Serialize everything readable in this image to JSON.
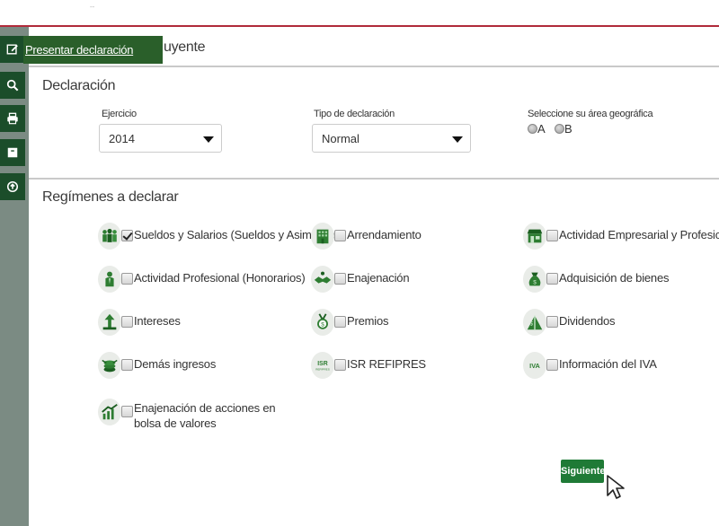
{
  "tooltip": {
    "label": "Presentar declaración"
  },
  "header": {
    "partial_title": "uyente"
  },
  "declaracion": {
    "title": "Declaración",
    "ejercicio": {
      "label": "Ejercicio",
      "value": "2014"
    },
    "tipo": {
      "label": "Tipo de declaración",
      "value": "Normal"
    },
    "area": {
      "label": "Seleccione su área geográfica",
      "option_a": "A",
      "option_b": "B"
    }
  },
  "regimenes": {
    "title": "Regímenes a declarar",
    "items": [
      {
        "label": "Sueldos y Salarios (Sueldos y Asimilados)",
        "checked": true,
        "icon": "workers-icon"
      },
      {
        "label": "Arrendamiento",
        "checked": false,
        "icon": "building-icon"
      },
      {
        "label": "Actividad Empresarial y Profesional",
        "checked": false,
        "icon": "storefront-icon"
      },
      {
        "label": "Actividad Profesional (Honorarios)",
        "checked": false,
        "icon": "professional-icon"
      },
      {
        "label": "Enajenación",
        "checked": false,
        "icon": "handshake-icon"
      },
      {
        "label": "Adquisición de bienes",
        "checked": false,
        "icon": "money-bag-icon"
      },
      {
        "label": "Intereses",
        "checked": false,
        "icon": "growth-arrow-icon"
      },
      {
        "label": "Premios",
        "checked": false,
        "icon": "medal-icon"
      },
      {
        "label": "Dividendos",
        "checked": false,
        "icon": "dividends-icon"
      },
      {
        "label": "Demás ingresos",
        "checked": false,
        "icon": "coins-icon"
      },
      {
        "label": "ISR REFIPRES",
        "checked": false,
        "icon": "isr-refipres-icon",
        "icon_text": "ISR",
        "icon_subtext": "REFIPRES"
      },
      {
        "label": "Información del IVA",
        "checked": false,
        "icon": "iva-icon",
        "icon_text": "IVA"
      },
      {
        "label": "Enajenación de acciones en bolsa de valores",
        "checked": false,
        "icon": "stock-chart-icon"
      }
    ]
  },
  "actions": {
    "next_label": "Siguiente"
  },
  "colors": {
    "brand_green": "#1f7a36",
    "dark_green": "#1b4d2a",
    "accent_red": "#b02a3a",
    "sidebar_gray": "#7b8b83"
  }
}
